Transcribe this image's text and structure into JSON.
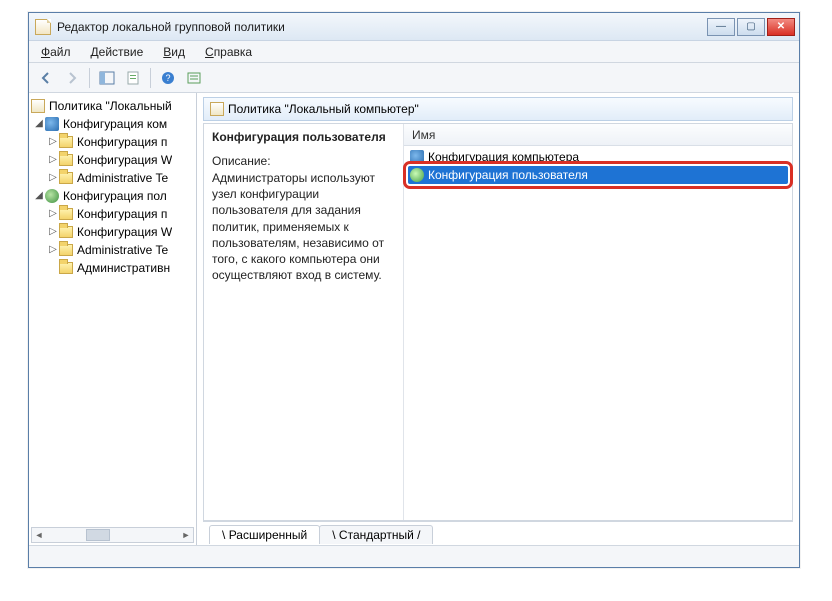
{
  "window": {
    "title": "Редактор локальной групповой политики"
  },
  "menu": {
    "file": "Файл",
    "action": "Действие",
    "view": "Вид",
    "help": "Справка"
  },
  "tree": {
    "root": "Политика \"Локальный",
    "cfg_computer": "Конфигурация ком",
    "c1": "Конфигурация п",
    "c2": "Конфигурация W",
    "c3": "Administrative Te",
    "cfg_user": "Конфигурация пол",
    "u1": "Конфигурация п",
    "u2": "Конфигурация W",
    "u3": "Administrative Te",
    "u4": "Административн"
  },
  "right": {
    "header": "Политика \"Локальный компьютер\"",
    "heading": "Конфигурация пользователя",
    "desc_label": "Описание:",
    "desc_text": "Администраторы используют узел конфигурации пользователя для задания политик, применяемых к пользователям, независимо от того, с какого компьютера они осуществляют вход в систему.",
    "column": "Имя",
    "items": [
      {
        "label": "Конфигурация компьютера"
      },
      {
        "label": "Конфигурация пользователя"
      }
    ]
  },
  "tabs": {
    "extended": "Расширенный",
    "standard": "Стандартный"
  }
}
